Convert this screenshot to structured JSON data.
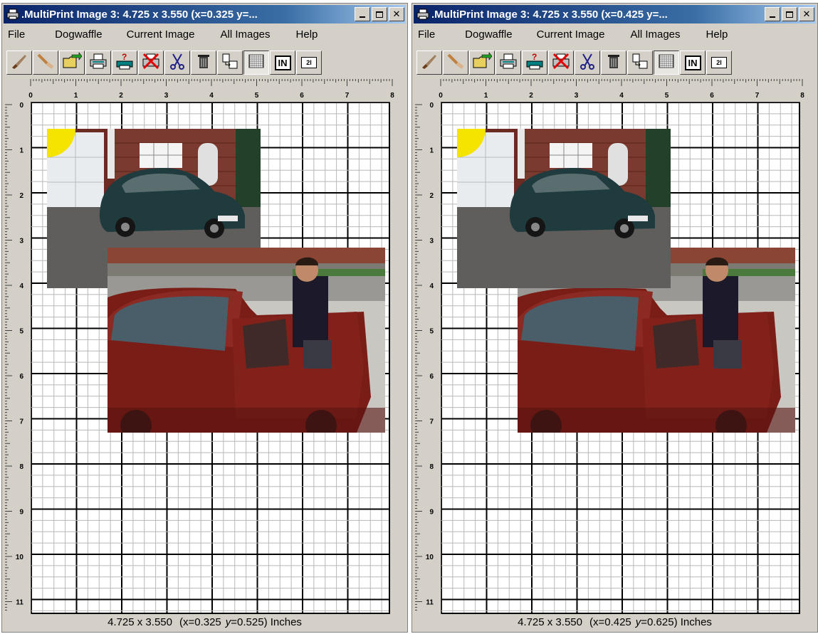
{
  "menu": [
    "File",
    "Dogwaffle",
    "Current Image",
    "All Images",
    "Help"
  ],
  "toolbar_buttons": [
    "brush-icon",
    "brush-erase-icon",
    "open-folder-icon",
    "print-icon",
    "print-help-icon",
    "print-cancel-icon",
    "scissors-icon",
    "trash-icon",
    "copy-layout-icon",
    "grid-icon",
    "inches-icon",
    "two-up-icon"
  ],
  "toolbar_labels": {
    "inches": "IN",
    "twoup": "2I"
  },
  "ruler": {
    "h": [
      "0",
      "1",
      "2",
      "3",
      "4",
      "5",
      "6",
      "7",
      "8"
    ],
    "v": [
      "0",
      "1",
      "2",
      "3",
      "4",
      "5",
      "6",
      "7",
      "8",
      "9",
      "10",
      "11"
    ]
  },
  "windows": [
    {
      "title": ".MultiPrint Image 3: 4.725 x 3.550  (x=0.325  y=...",
      "status_dims": "4.725 x 3.550",
      "status_pos_x": "(x=0.325",
      "status_pos_y_label": "y",
      "status_pos_y": "=0.525) Inches"
    },
    {
      "title": ".MultiPrint Image 3: 4.725 x 3.550  (x=0.425  y=...",
      "status_dims": "4.725 x 3.550",
      "status_pos_x": "(x=0.425",
      "status_pos_y_label": "y",
      "status_pos_y": "=0.625) Inches"
    }
  ],
  "colors": {
    "title_start": "#0a246a",
    "title_end": "#a6caf0",
    "face": "#d4d0c8",
    "grid_major": "#000000",
    "grid_minor": "#b8b8b8",
    "sun": "#f5e400"
  }
}
